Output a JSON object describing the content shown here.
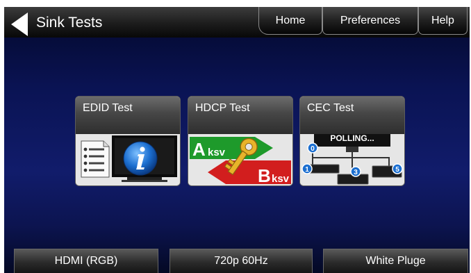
{
  "header": {
    "title": "Sink Tests",
    "nav": {
      "home": "Home",
      "preferences": "Preferences",
      "help": "Help"
    }
  },
  "tiles": [
    {
      "label": "EDID Test",
      "icon": "edid-info-icon"
    },
    {
      "label": "HDCP Test",
      "icon": "hdcp-key-icon",
      "a": "A",
      "a_sub": "ksv",
      "b": "B",
      "b_sub": "ksv"
    },
    {
      "label": "CEC Test",
      "icon": "cec-polling-icon",
      "screen_text": "POLLING...",
      "nodes": [
        "0",
        "1",
        "3",
        "5"
      ]
    }
  ],
  "status": {
    "interface": "HDMI (RGB)",
    "format": "720p 60Hz",
    "pattern": "White Pluge"
  },
  "colors": {
    "background": "#111c6b",
    "hdcp_green": "#1e9a2b",
    "hdcp_red": "#d21e1e",
    "key_gold": "#e8b32a",
    "info_blue": "#1c6fd0"
  }
}
